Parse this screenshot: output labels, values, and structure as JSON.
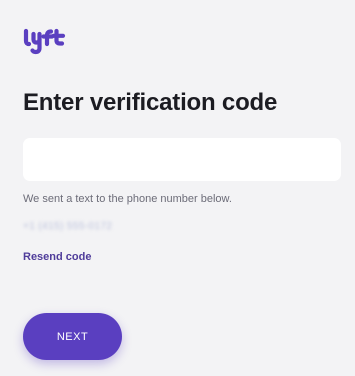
{
  "brand": {
    "logo_text": "lyft",
    "color": "#5a3fc0"
  },
  "page": {
    "title": "Enter verification code"
  },
  "code_field": {
    "value": "",
    "placeholder": ""
  },
  "helper_text": "We sent a text to the phone number below.",
  "phone_number": "+1 (415) 555-0172",
  "resend_label": "Resend code",
  "next_button": {
    "label": "NEXT"
  }
}
